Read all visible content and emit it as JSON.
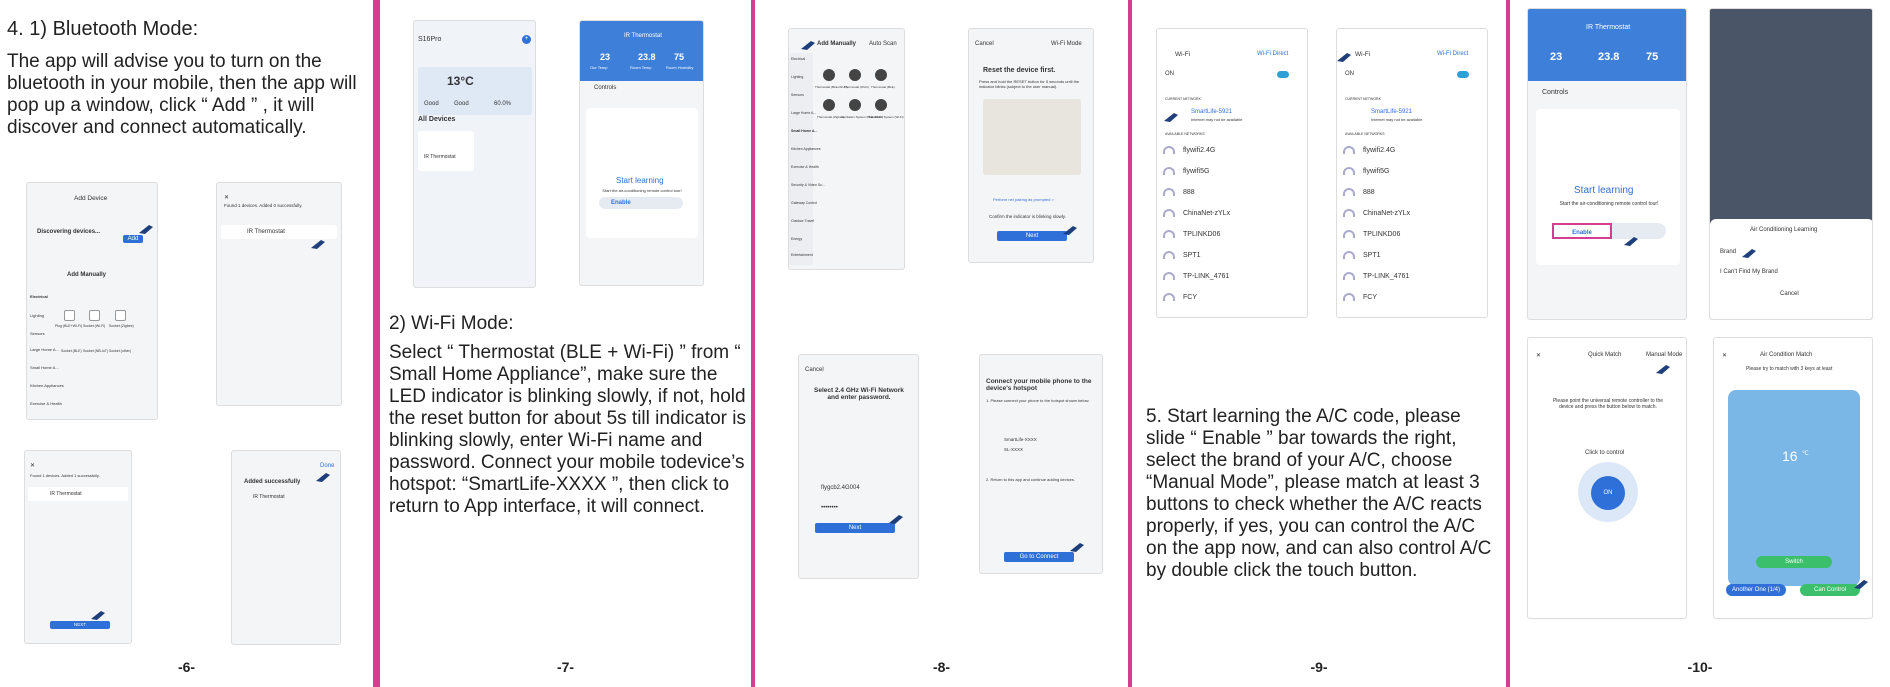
{
  "p6": {
    "heading": "4.  1) Bluetooth Mode:",
    "para": "The app will advise you to turn on the bluetooth in your mobile, then the app will pop up a window,  click “ Add ” , it will discover and connect automatically.",
    "page_num": "-6-",
    "s1": {
      "title": "Add Device",
      "disc": "Discovering devices...",
      "add": "Add",
      "manual": "Add Manually",
      "cats": [
        "Electrical",
        "Lighting",
        "Sensors",
        "Large Home A...",
        "Small Home A...",
        "Kitchen Appliances",
        "Exercise & Health"
      ],
      "devs": [
        "Plug (BLE+Wi-Fi)",
        "Socket (Wi-Fi)",
        "Socket (Zigbee)",
        "Socket (BLE)",
        "Socket (NB-IoT)",
        "Socket (other)"
      ]
    },
    "s2": {
      "found": "Found 1 devices. Added 0 successfully.",
      "dev": "IR Thermostat"
    },
    "s3": {
      "found": "Found 1 devices. Added 1 successfully.",
      "dev": "IR Thermostat",
      "next": "NEXT"
    },
    "s4": {
      "done": "Done",
      "added": "Added successfully",
      "dev": "IR Thermostat"
    }
  },
  "p7": {
    "heading": "2) Wi-Fi Mode:",
    "para": "Select “ Thermostat (BLE + Wi-Fi) ” from “ Small Home Appliance”,  make sure the LED indicator is blinking slowly, if not, hold the reset button for about 5s till indicator is blinking slowly, enter Wi-Fi name and password. Connect your mobile todevice’s hotspot: “SmartLife-XXXX ”, then click to return to App interface,  it will connect.",
    "page_num": "-7-",
    "home": {
      "user": "S16Pro",
      "temp": "13°C",
      "w1": "Good",
      "w2": "Good",
      "w3": "60.0%",
      "all": "All Devices",
      "dev": "IR Thermostat"
    },
    "thermo": {
      "title": "IR Thermostat",
      "t1": "23",
      "t2": "23.8",
      "t3": "75",
      "l1": "Our Temp",
      "l2": "Room Temp",
      "l3": "Room Humidity",
      "tab": "Controls",
      "learn": "Start learning",
      "desc": "Start the air-conditioning remote control tour!",
      "enable": "Enable"
    }
  },
  "p8": {
    "page_num": "-8-",
    "s1": {
      "title": "Add Manually",
      "auto": "Auto Scan",
      "cats": [
        "Electrical",
        "Lighting",
        "Sensors",
        "Large Home A...",
        "Small Home A...",
        "Kitchen Appliances",
        "Exercise & Health",
        "Security & Video Su...",
        "Gateway Control",
        "Outdoor Travel",
        "Energy",
        "Entertainment"
      ],
      "devs": [
        "Thermostat (BLE+Wi-Fi)",
        "Thermostat (Wi-Fi)",
        "Thermostat (BLE)",
        "Thermostat (Zigbee)",
        "Ventilation System (BLE+Wi-Fi)",
        "Ventilation System (Wi-Fi)"
      ]
    },
    "s2": {
      "cancel": "Cancel",
      "mode": "Wi-Fi Mode",
      "title": "Reset the device first.",
      "desc": "Press and hold the RESET button for 5 seconds until the indicator blinks (subject to the user manual).",
      "hint": "Perform net pairing as prompted >",
      "confirm": "Confirm the indicator is blinking slowly.",
      "next": "Next"
    },
    "s3": {
      "cancel": "Cancel",
      "title": "Select 2.4 GHz Wi-Fi Network and enter password.",
      "ssid": "flygcb2.4G004",
      "pw": "••••••••",
      "next": "Next"
    },
    "s4": {
      "title": "Connect your mobile phone to the device's hotspot",
      "step": "1. Please connect your phone to the hotspot shown below.",
      "h1": "SmartLife-XXXX",
      "h2": "SL-XXXX",
      "step2": "2. Return to this app and continue adding devices.",
      "go": "Go to Connect"
    }
  },
  "p9": {
    "para": "5.  Start learning the A/C code, please slide “ Enable ” bar towards the right, select the brand of your A/C, choose “Manual Mode”, please match at least 3 buttons to check whether the A/C reacts properly, if yes, you can control the A/C on the app now, and can also control A/C by double click the touch button.",
    "page_num": "-9-",
    "wifi": {
      "title": "Wi-Fi",
      "direct": "Wi-Fi Direct",
      "on": "ON",
      "current": "CURRENT NETWORK",
      "conn": "SmartLife-5921",
      "sub": "Internet may not be available",
      "avail": "AVAILABLE NETWORKS",
      "nets": [
        "flywifi2.4G",
        "flywifi5G",
        "888",
        "ChinaNet-zYLx",
        "TPLINKD06",
        "SPT1",
        "TP-LINK_4761",
        "FCY"
      ]
    }
  },
  "p10": {
    "page_num": "-10-",
    "t1": {
      "title": "IR Thermostat",
      "tab": "Controls",
      "learn": "Start learning",
      "desc": "Start the air-conditioning remote control tour!",
      "enable": "Enable"
    },
    "t2": {
      "sheet": "Air Conditioning Learning",
      "brand": "Brand",
      "cant": "I Can't Find My Brand",
      "cancel": "Cancel"
    },
    "m1": {
      "title": "Quick Match",
      "manual": "Manual Mode",
      "desc": "Please point the universal remote controller to the device and press the button below to match.",
      "click": "Click to control",
      "on": "ON"
    },
    "m2": {
      "title": "Air Condition Match",
      "desc": "Please try to match with 3 keys at least",
      "temp": "16",
      "unit": "℃",
      "switch": "Switch",
      "another": "Another One (1/4)",
      "can": "Can Control"
    }
  }
}
